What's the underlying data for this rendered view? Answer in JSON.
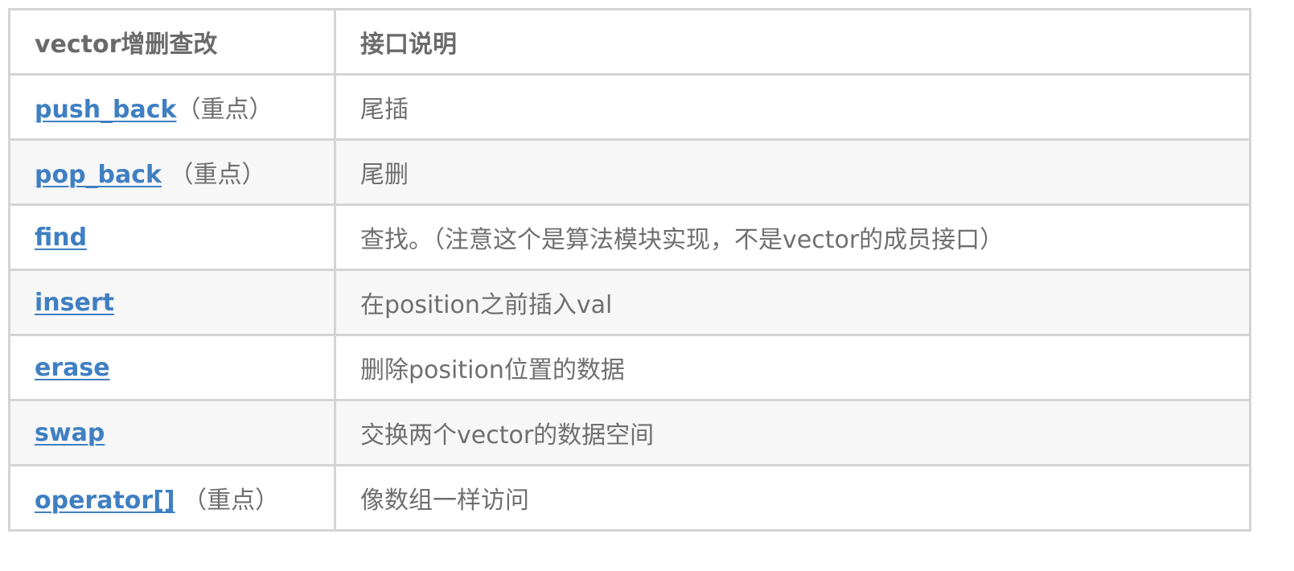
{
  "table": {
    "header": {
      "operation": "vector增删查改",
      "description": "接口说明"
    },
    "rows": [
      {
        "name": "push_back",
        "note": "（重点）",
        "description": "尾插"
      },
      {
        "name": "pop_back",
        "note": " （重点）",
        "description": "尾删"
      },
      {
        "name": "find",
        "note": "",
        "description": "查找。（注意这个是算法模块实现，不是vector的成员接口）"
      },
      {
        "name": "insert",
        "note": "",
        "description": "在position之前插入val"
      },
      {
        "name": "erase",
        "note": "",
        "description": "删除position位置的数据"
      },
      {
        "name": "swap",
        "note": "",
        "description": "交换两个vector的数据空间"
      },
      {
        "name": "operator[]",
        "note": " （重点）",
        "description": "像数组一样访问"
      }
    ]
  },
  "colors": {
    "link": "#3f7fc2",
    "text": "#6f6f6f",
    "border": "#d4d4d4",
    "stripe": "#f7f7f7"
  }
}
